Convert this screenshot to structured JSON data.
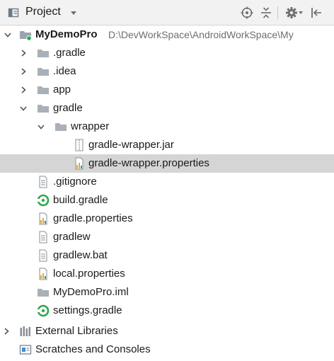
{
  "panel": {
    "title": "Project",
    "title_icon": "project-view-icon",
    "dropdown_icon": "chevron-down-icon",
    "toolbar_icons": [
      "locate-crosshair-icon",
      "collapse-all-icon",
      "gear-icon",
      "hide-panel-icon"
    ]
  },
  "tree": {
    "root": {
      "label": "MyDemoPro",
      "path": "D:\\DevWorkSpace\\AndroidWorkSpace\\My",
      "expanded": true,
      "icon": "module-folder-icon"
    },
    "items": [
      {
        "label": ".gradle",
        "icon": "folder-icon",
        "expanded": false
      },
      {
        "label": ".idea",
        "icon": "folder-icon",
        "expanded": false
      },
      {
        "label": "app",
        "icon": "folder-icon",
        "expanded": false
      },
      {
        "label": "gradle",
        "icon": "folder-icon",
        "expanded": true
      },
      {
        "label": "wrapper",
        "icon": "folder-icon",
        "expanded": true
      },
      {
        "label": "gradle-wrapper.jar",
        "icon": "jar-file-icon"
      },
      {
        "label": "gradle-wrapper.properties",
        "icon": "properties-file-icon",
        "selected": true
      },
      {
        "label": ".gitignore",
        "icon": "text-file-icon"
      },
      {
        "label": "build.gradle",
        "icon": "gradle-file-icon"
      },
      {
        "label": "gradle.properties",
        "icon": "properties-file-icon"
      },
      {
        "label": "gradlew",
        "icon": "text-file-icon"
      },
      {
        "label": "gradlew.bat",
        "icon": "text-file-icon"
      },
      {
        "label": "local.properties",
        "icon": "properties-file-icon"
      },
      {
        "label": "MyDemoPro.iml",
        "icon": "iml-file-icon"
      },
      {
        "label": "settings.gradle",
        "icon": "gradle-file-icon"
      }
    ],
    "external_libraries": {
      "label": "External Libraries",
      "icon": "libraries-icon",
      "expanded": false
    },
    "scratches": {
      "label": "Scratches and Consoles",
      "icon": "scratches-icon"
    }
  },
  "colors": {
    "selection": "#d5d5d5",
    "folder": "#a9b0b8",
    "gradle_green": "#2fa84f",
    "properties_bars": "#e8a33d"
  }
}
